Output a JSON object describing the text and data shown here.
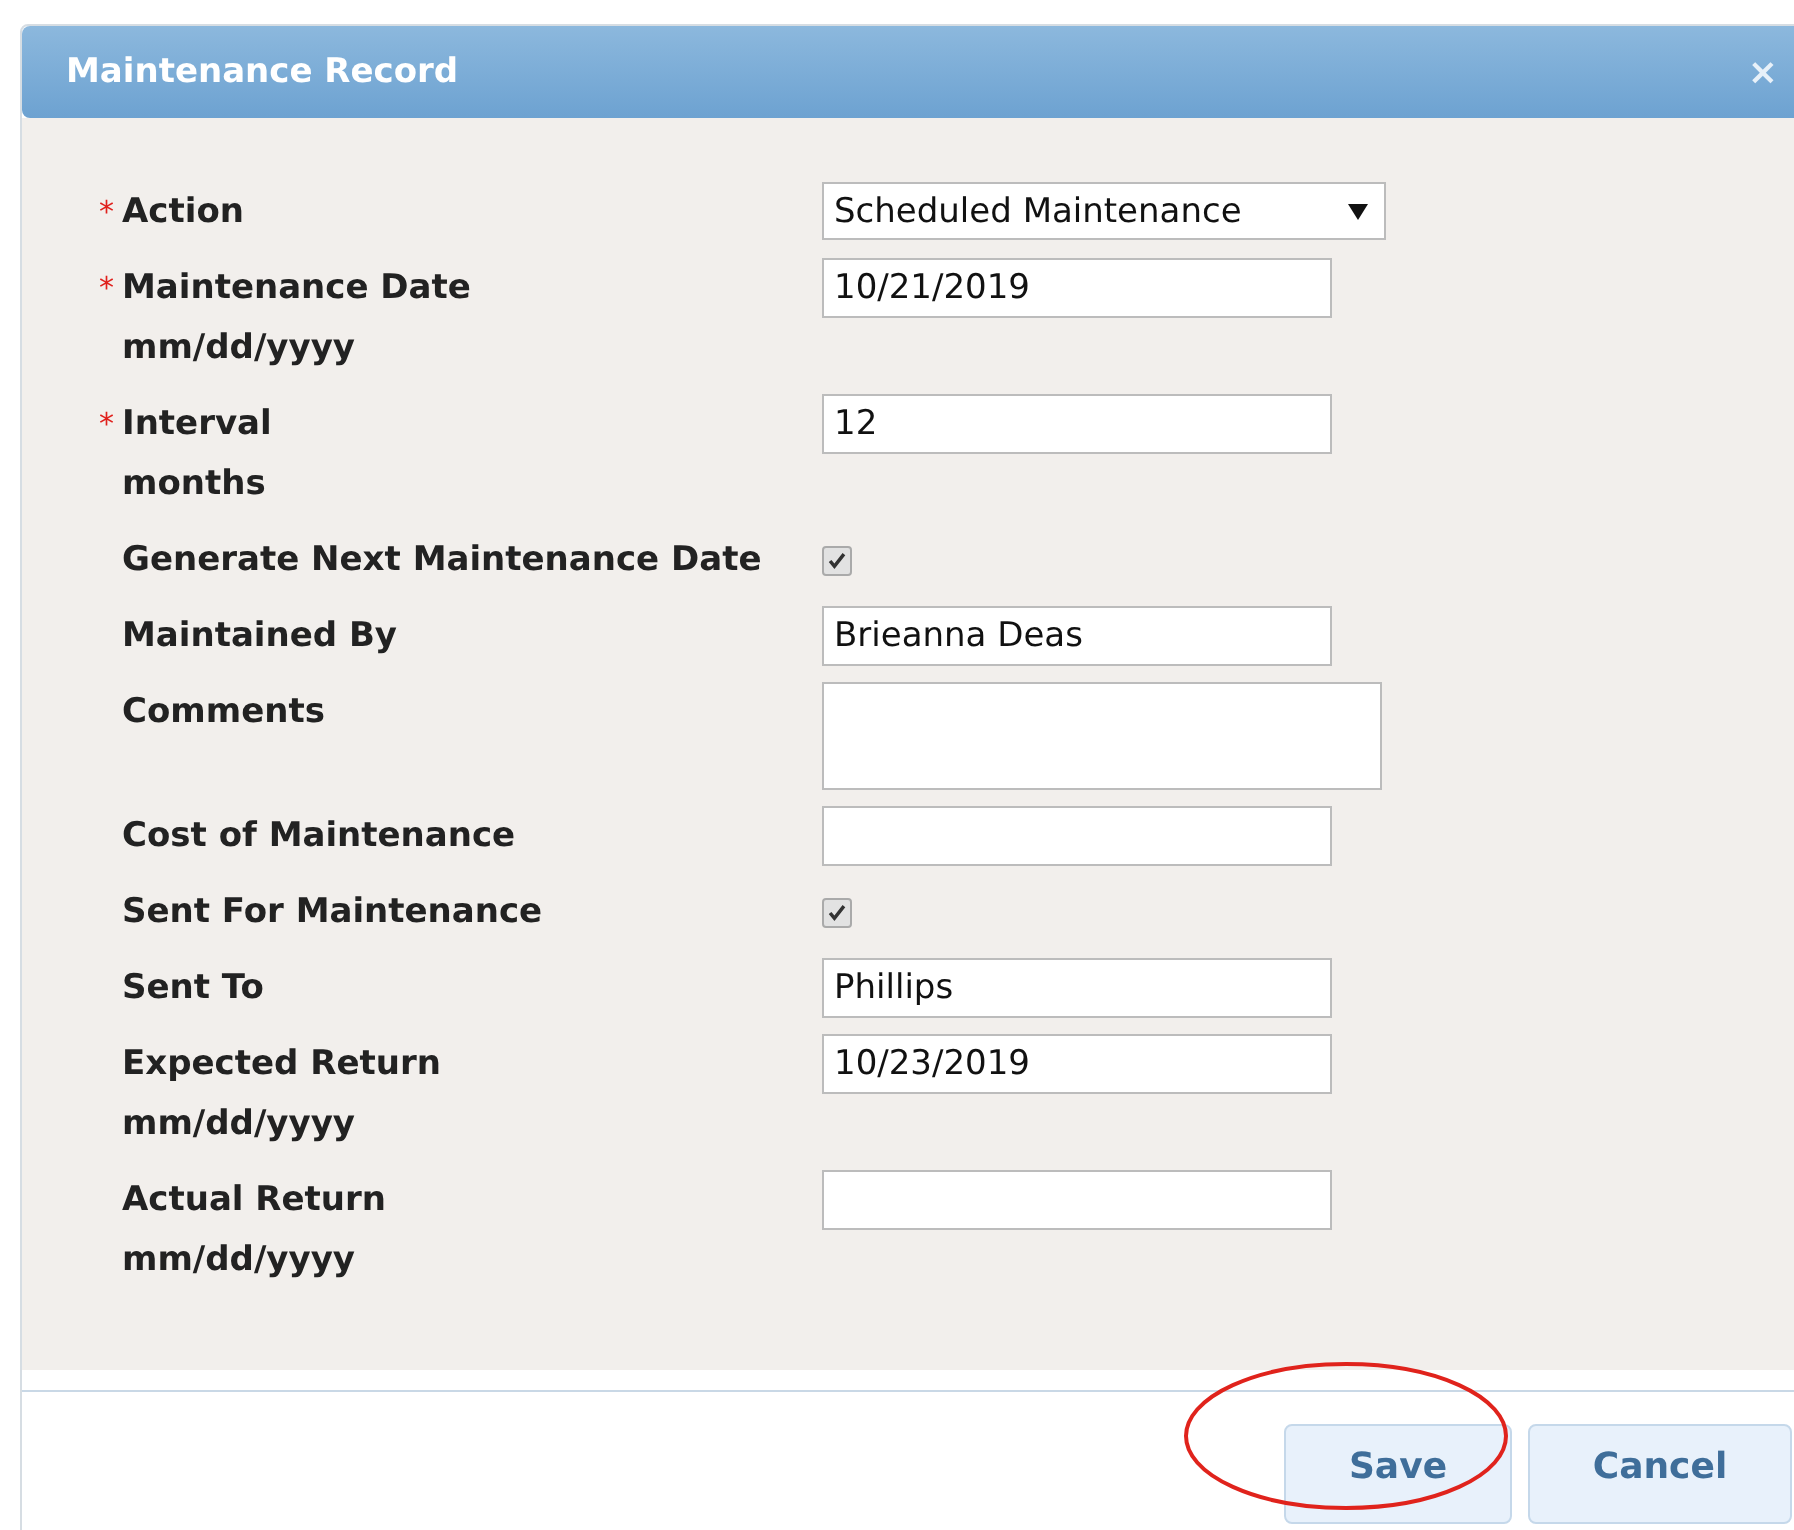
{
  "dialog": {
    "title": "Maintenance Record",
    "close": "×",
    "fields": [
      {
        "kind": "select",
        "required_mark": "*",
        "label": "Action",
        "value": "Scheduled Maintenance"
      },
      {
        "kind": "text",
        "required_mark": "*",
        "label": "Maintenance Date",
        "hint": "mm/dd/yyyy",
        "value": "10/21/2019"
      },
      {
        "kind": "text",
        "required_mark": "*",
        "label": "Interval",
        "hint": "months",
        "value": "12"
      },
      {
        "kind": "checkbox",
        "label": "Generate Next Maintenance Date",
        "checked": true
      },
      {
        "kind": "text",
        "label": "Maintained By",
        "value": "Brieanna Deas"
      },
      {
        "kind": "textarea",
        "label": "Comments"
      },
      {
        "kind": "text",
        "label": "Cost of Maintenance"
      },
      {
        "kind": "checkbox",
        "label": "Sent For Maintenance",
        "checked": true
      },
      {
        "kind": "text",
        "label": "Sent To",
        "value": "Phillips"
      },
      {
        "kind": "text",
        "label": "Expected Return",
        "hint": "mm/dd/yyyy",
        "value": "10/23/2019"
      },
      {
        "kind": "text",
        "label": "Actual Return",
        "hint": "mm/dd/yyyy"
      }
    ],
    "buttons": [
      {
        "label": "Save"
      },
      {
        "label": "Cancel"
      }
    ],
    "annotations": [
      {
        "kind": "ellipse"
      }
    ]
  }
}
